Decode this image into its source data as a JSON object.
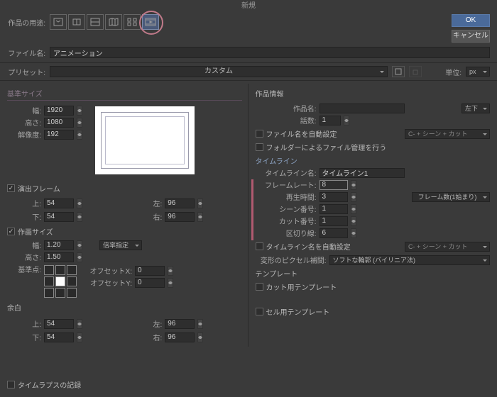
{
  "title": "新規",
  "labels": {
    "purpose": "作品の用途:",
    "filename": "ファイル名:",
    "preset": "プリセット:",
    "unit": "単位:"
  },
  "buttons": {
    "ok": "OK",
    "cancel": "キャンセル"
  },
  "filename_value": "アニメーション",
  "preset_value": "カスタム",
  "unit_value": "px",
  "left": {
    "base_size": "基準サイズ",
    "width": "幅:",
    "width_v": "1920",
    "height": "高さ:",
    "height_v": "1080",
    "res": "解像度:",
    "res_v": "192",
    "enshutsu": "演出フレーム",
    "top": "上:",
    "top_v": "54",
    "bottom": "下:",
    "bottom_v": "54",
    "l": "左:",
    "l_v": "96",
    "r": "右:",
    "r_v": "96",
    "sakuga": "作画サイズ",
    "sw": "幅:",
    "sw_v": "1.20",
    "sh": "高さ:",
    "sh_v": "1.50",
    "bairitsu": "倍率指定",
    "anchor": "基準点:",
    "ox": "オフセットX:",
    "ox_v": "0",
    "oy": "オフセットY:",
    "oy_v": "0",
    "yohaku": "余白",
    "yt": "上:",
    "yt_v": "54",
    "yb": "下:",
    "yb_v": "54",
    "yl": "左:",
    "yl_v": "96",
    "yr": "右:",
    "yr_v": "96"
  },
  "right": {
    "info": "作品情報",
    "name": "作品名:",
    "name_v": "",
    "pos": "左下",
    "ep": "話数:",
    "ep_v": "1",
    "autofile": "ファイル名を自動設定",
    "scenecut": "C- + シーン + カット",
    "folder": "フォルダーによるファイル管理を行う",
    "timeline": "タイムライン",
    "tlname": "タイムライン名:",
    "tlname_v": "タイムライン1",
    "fr": "フレームレート:",
    "fr_v": "8",
    "play": "再生時間:",
    "play_v": "3",
    "frame_type": "フレーム数(1始まり)",
    "scene": "シーン番号:",
    "scene_v": "1",
    "cut": "カット番号:",
    "cut_v": "1",
    "divider": "区切り線:",
    "divider_v": "6",
    "autotl": "タイムライン名を自動設定",
    "interp": "変形のピクセル補間:",
    "interp_v": "ソフトな輪郭 (バイリニア法)",
    "template": "テンプレート",
    "cuttpl": "カット用テンプレート",
    "celtpl": "セル用テンプレート"
  },
  "footer": {
    "timelapse": "タイムラプスの記録"
  }
}
